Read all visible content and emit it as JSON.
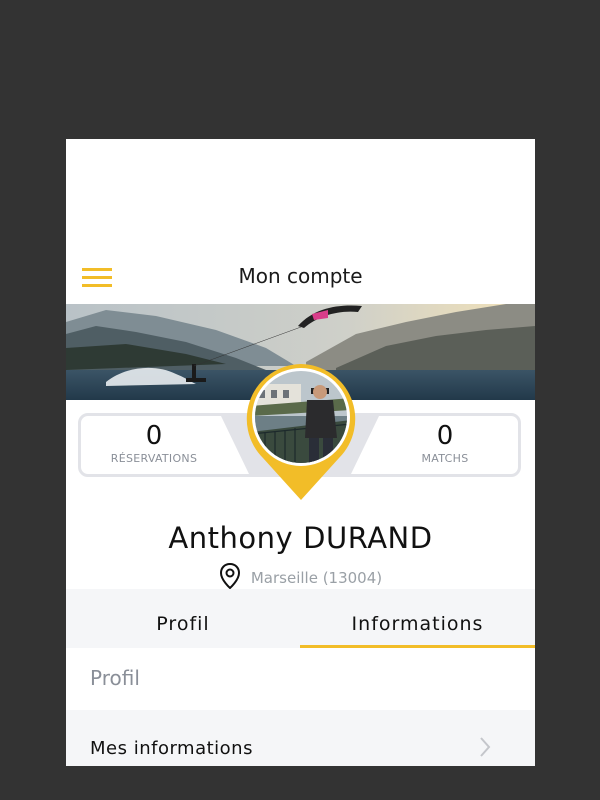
{
  "header": {
    "title": "Mon compte",
    "menu_icon": "hamburger-menu-icon",
    "accent_color": "#f2bd28"
  },
  "banner": {
    "image": "kitesurf-lake-banner"
  },
  "stats": {
    "reservations": {
      "value": "0",
      "label": "RÉSERVATIONS"
    },
    "matchs": {
      "value": "0",
      "label": "MATCHS"
    }
  },
  "profile": {
    "first_name": "Anthony",
    "last_name": "DURAND",
    "location": "Marseille (13004)",
    "location_icon": "map-pin-icon",
    "avatar": "user-avatar-photo"
  },
  "tabs": [
    {
      "label": "Profil",
      "active": false
    },
    {
      "label": "Informations",
      "active": true
    }
  ],
  "section": {
    "title": "Profil",
    "rows": [
      {
        "label": "Mes informations",
        "icon": "chevron-right-icon"
      }
    ]
  }
}
